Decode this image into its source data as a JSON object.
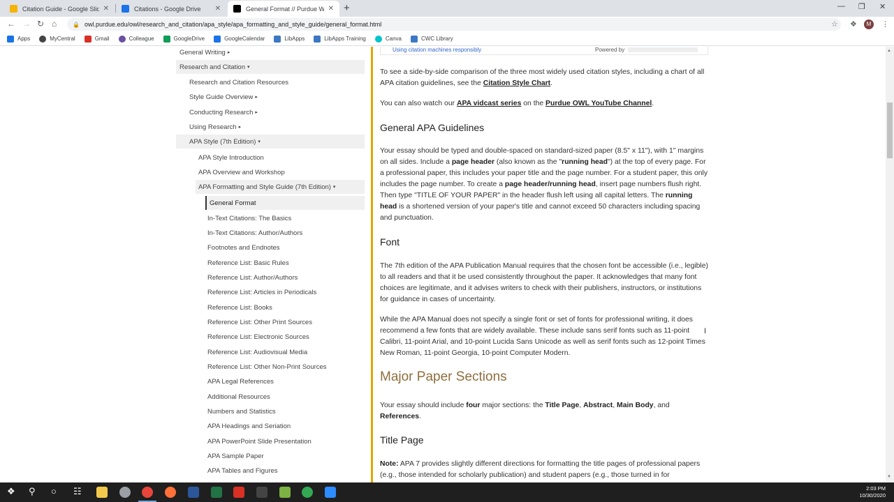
{
  "browser": {
    "tabs": [
      {
        "title": "Citation Guide - Google Slides",
        "favicon_color": "#f4b400"
      },
      {
        "title": "Citations - Google Drive",
        "favicon_color": "#1a73e8"
      },
      {
        "title": "General Format // Purdue Writin",
        "favicon_color": "#000000"
      }
    ],
    "new_tab_label": "+",
    "close_label": "✕",
    "url": "owl.purdue.edu/owl/research_and_citation/apa_style/apa_formatting_and_style_guide/general_format.html",
    "profile_initial": "M",
    "bookmarks": [
      {
        "label": "Apps",
        "icon": "apps-grid-icon",
        "color": "#1a73e8"
      },
      {
        "label": "MyCentral",
        "icon": "mycentral-icon",
        "color": "#444444"
      },
      {
        "label": "Gmail",
        "icon": "gmail-icon",
        "color": "#d93025"
      },
      {
        "label": "Colleague",
        "icon": "colleague-icon",
        "color": "#6a4fa3"
      },
      {
        "label": "GoogleDrive",
        "icon": "drive-icon",
        "color": "#0f9d58"
      },
      {
        "label": "GoogleCalendar",
        "icon": "calendar-icon",
        "color": "#1a73e8"
      },
      {
        "label": "LibApps",
        "icon": "libapps-icon",
        "color": "#3c78c3"
      },
      {
        "label": "LibApps Training",
        "icon": "libapps-icon",
        "color": "#3c78c3"
      },
      {
        "label": "Canva",
        "icon": "canva-icon",
        "color": "#00c4cc"
      },
      {
        "label": "CWC Library",
        "icon": "cwc-icon",
        "color": "#3c78c3"
      }
    ]
  },
  "sidebar": {
    "items": [
      {
        "label": "General Writing",
        "caret": "▸"
      },
      {
        "label": "Research and Citation",
        "caret": "▾"
      },
      {
        "label": "Research and Citation Resources",
        "caret": ""
      },
      {
        "label": "Style Guide Overview",
        "caret": "▸"
      },
      {
        "label": "Conducting Research",
        "caret": "▸"
      },
      {
        "label": "Using Research",
        "caret": "▸"
      },
      {
        "label": "APA Style (7th Edition)",
        "caret": "▾"
      },
      {
        "label": "APA Style Introduction",
        "caret": ""
      },
      {
        "label": "APA Overview and Workshop",
        "caret": ""
      },
      {
        "label": "APA Formatting and Style Guide (7th Edition)",
        "caret": "▾"
      },
      {
        "label": "General Format",
        "caret": ""
      },
      {
        "label": "In-Text Citations: The Basics",
        "caret": ""
      },
      {
        "label": "In-Text Citations: Author/Authors",
        "caret": ""
      },
      {
        "label": "Footnotes and Endnotes",
        "caret": ""
      },
      {
        "label": "Reference List: Basic Rules",
        "caret": ""
      },
      {
        "label": "Reference List: Author/Authors",
        "caret": ""
      },
      {
        "label": "Reference List: Articles in Periodicals",
        "caret": ""
      },
      {
        "label": "Reference List: Books",
        "caret": ""
      },
      {
        "label": "Reference List: Other Print Sources",
        "caret": ""
      },
      {
        "label": "Reference List: Electronic Sources",
        "caret": ""
      },
      {
        "label": "Reference List: Audiovisual Media",
        "caret": ""
      },
      {
        "label": "Reference List: Other Non-Print Sources",
        "caret": ""
      },
      {
        "label": "APA Legal References",
        "caret": ""
      },
      {
        "label": "Additional Resources",
        "caret": ""
      },
      {
        "label": "Numbers and Statistics",
        "caret": ""
      },
      {
        "label": "APA Headings and Seriation",
        "caret": ""
      },
      {
        "label": "APA PowerPoint Slide Presentation",
        "caret": ""
      },
      {
        "label": "APA Sample Paper",
        "caret": ""
      },
      {
        "label": "APA Tables and Figures",
        "caret": ""
      }
    ]
  },
  "content": {
    "banner_link": "Using citation machines responsibly",
    "banner_powered": "Powered by",
    "p_chart": {
      "t1": "To see a side-by-side comparison of the three most widely used citation styles, including a chart of all APA citation guidelines, see the ",
      "link": "Citation Style Chart",
      "t2": "."
    },
    "p_vidcast": {
      "t1": "You can also watch our ",
      "link1": "APA vidcast series",
      "t2": " on the ",
      "link2": "Purdue OWL YouTube Channel",
      "t3": "."
    },
    "h_guidelines": "General APA Guidelines",
    "p_guidelines": {
      "t1": "Your essay should be typed and double-spaced on standard-sized paper (8.5\" x 11\"), with 1\" margins on all sides.  Include a ",
      "b1": "page header",
      "t2": " (also known as the \"",
      "b2": "running head",
      "t3": "\") at the top of every page. For a professional paper, this includes your paper title and the page number. For a student paper, this only includes the page number. To create a ",
      "b3": "page header/running head",
      "t4": ", insert page numbers flush right. Then type \"TITLE OF YOUR PAPER\" in the header flush left using all capital letters. The ",
      "b4": "running head",
      "t5": " is a shortened version of your paper's title and cannot exceed 50 characters including spacing and punctuation."
    },
    "h_font": "Font",
    "p_font1": "The 7th edition of the APA Publication Manual requires that the chosen font be accessible (i.e., legible) to all readers and that it be used consistently throughout the paper. It acknowledges that many font choices are legitimate, and it advises writers to check with their publishers, instructors, or institutions for guidance in cases of uncertainty.",
    "p_font2": "While the APA Manual does not specify a single font or set of  fonts for professional writing, it does recommend a few fonts that are widely available. These include sans serif fonts such as 11-point Calibri, 11-point Arial, and 10-point Lucida Sans Unicode as well as serif fonts such as 12-point Times New Roman, 11-point Georgia, 10-point Computer Modern.",
    "h_major": "Major Paper Sections",
    "p_major": {
      "t1": "Your essay should include ",
      "b1": "four",
      "t2": " major sections: the ",
      "b2": "Title Page",
      "t3": ", ",
      "b3": "Abstract",
      "t4": ", ",
      "b4": "Main Body",
      "t5": ", and ",
      "b5": "References",
      "t6": "."
    },
    "h_title": "Title Page",
    "p_title": {
      "b1": "Note:",
      "t1": " APA 7 provides slightly different directions for formatting the title pages of professional papers (e.g., those intended for scholarly publication) and student papers (e.g., those turned in for"
    }
  },
  "taskbar": {
    "time": "2:03 PM",
    "date": "10/30/2020"
  }
}
